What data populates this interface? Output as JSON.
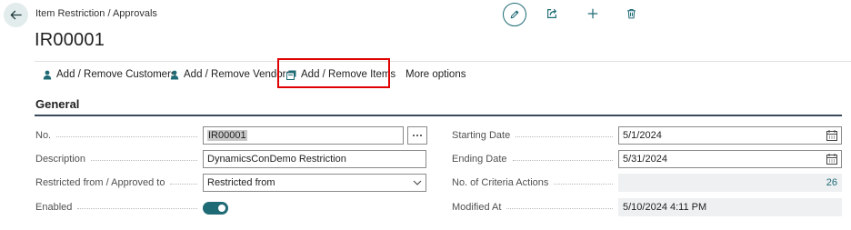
{
  "header": {
    "breadcrumb": "Item Restriction / Approvals",
    "record_title": "IR00001",
    "icons": [
      "back-arrow-icon",
      "edit-pencil-icon",
      "share-icon",
      "new-plus-icon",
      "delete-trash-icon"
    ]
  },
  "actions": [
    {
      "label": "Add / Remove Customers",
      "icon": "person-icon"
    },
    {
      "label": "Add / Remove Vendors",
      "icon": "person-icon"
    },
    {
      "label": "Add / Remove Items",
      "icon": "items-icon"
    },
    {
      "label": "More options"
    }
  ],
  "section": {
    "title": "General"
  },
  "fields_left": [
    {
      "label": "No.",
      "value": "IR00001"
    },
    {
      "label": "Description",
      "value": "DynamicsConDemo Restriction"
    },
    {
      "label": "Restricted from / Approved to",
      "value": "Restricted from"
    },
    {
      "label": "Enabled",
      "value": true
    }
  ],
  "fields_right": [
    {
      "label": "Starting Date",
      "value": "5/1/2024"
    },
    {
      "label": "Ending Date",
      "value": "5/31/2024"
    },
    {
      "label": "No. of Criteria Actions",
      "value": "26"
    },
    {
      "label": "Modified At",
      "value": "5/10/2024 4:11 PM"
    }
  ],
  "colors": {
    "accent": "#1f6b75",
    "highlight": "#e00000",
    "readonly_bg": "#eef0f2"
  }
}
